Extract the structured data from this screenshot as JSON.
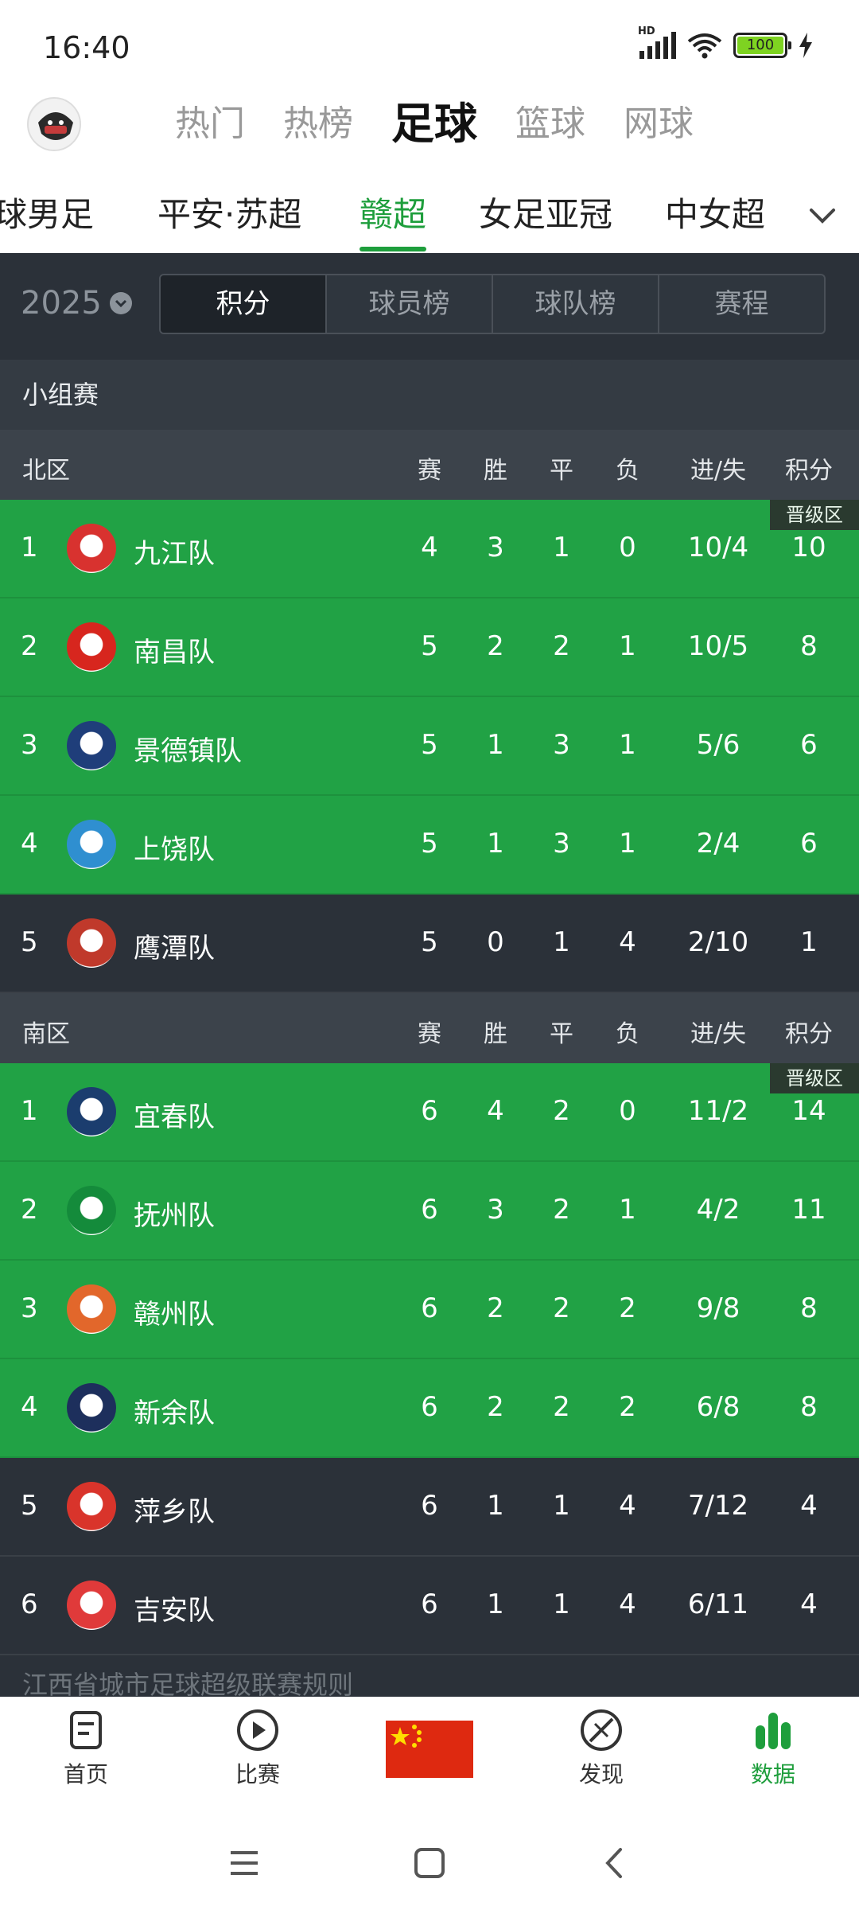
{
  "status_bar": {
    "time": "16:40",
    "network_label": "HD",
    "battery_level": "100",
    "icons": [
      "signal-icon",
      "wifi-icon",
      "battery-icon",
      "charging-icon"
    ]
  },
  "header": {
    "sport_tabs": [
      "热门",
      "热榜",
      "足球",
      "篮球",
      "网球"
    ],
    "active_sport": "足球"
  },
  "league_tabs": {
    "items": [
      "球男足",
      "平安·苏超",
      "赣超",
      "女足亚冠",
      "中女超"
    ],
    "active": "赣超"
  },
  "season": {
    "label": "2025"
  },
  "segments": {
    "items": [
      "积分",
      "球员榜",
      "球队榜",
      "赛程"
    ],
    "active": "积分"
  },
  "stage_title": "小组赛",
  "columns": {
    "gp": "赛",
    "w": "胜",
    "d": "平",
    "l": "负",
    "gd": "进/失",
    "pts": "积分"
  },
  "promotion_label": "晋级区",
  "zones": [
    {
      "name": "北区",
      "rows": [
        {
          "rank": "1",
          "team": "九江队",
          "gp": "4",
          "w": "3",
          "d": "1",
          "l": "0",
          "gd": "10/4",
          "pts": "10",
          "zone": "promotion",
          "logo_color": "#d8322f"
        },
        {
          "rank": "2",
          "team": "南昌队",
          "gp": "5",
          "w": "2",
          "d": "2",
          "l": "1",
          "gd": "10/5",
          "pts": "8",
          "zone": "promotion",
          "logo_color": "#d7261e"
        },
        {
          "rank": "3",
          "team": "景德镇队",
          "gp": "5",
          "w": "1",
          "d": "3",
          "l": "1",
          "gd": "5/6",
          "pts": "6",
          "zone": "promotion",
          "logo_color": "#1f3e7a"
        },
        {
          "rank": "4",
          "team": "上饶队",
          "gp": "5",
          "w": "1",
          "d": "3",
          "l": "1",
          "gd": "2/4",
          "pts": "6",
          "zone": "promotion",
          "logo_color": "#2f8fd0"
        },
        {
          "rank": "5",
          "team": "鹰潭队",
          "gp": "5",
          "w": "0",
          "d": "1",
          "l": "4",
          "gd": "2/10",
          "pts": "1",
          "zone": "none",
          "logo_color": "#c0392b"
        }
      ]
    },
    {
      "name": "南区",
      "rows": [
        {
          "rank": "1",
          "team": "宜春队",
          "gp": "6",
          "w": "4",
          "d": "2",
          "l": "0",
          "gd": "11/2",
          "pts": "14",
          "zone": "promotion",
          "logo_color": "#1b3d6e"
        },
        {
          "rank": "2",
          "team": "抚州队",
          "gp": "6",
          "w": "3",
          "d": "2",
          "l": "1",
          "gd": "4/2",
          "pts": "11",
          "zone": "promotion",
          "logo_color": "#148b3b"
        },
        {
          "rank": "3",
          "team": "赣州队",
          "gp": "6",
          "w": "2",
          "d": "2",
          "l": "2",
          "gd": "9/8",
          "pts": "8",
          "zone": "promotion",
          "logo_color": "#e2672b"
        },
        {
          "rank": "4",
          "team": "新余队",
          "gp": "6",
          "w": "2",
          "d": "2",
          "l": "2",
          "gd": "6/8",
          "pts": "8",
          "zone": "promotion",
          "logo_color": "#1d2f5c"
        },
        {
          "rank": "5",
          "team": "萍乡队",
          "gp": "6",
          "w": "1",
          "d": "1",
          "l": "4",
          "gd": "7/12",
          "pts": "4",
          "zone": "none",
          "logo_color": "#d9342b"
        },
        {
          "rank": "6",
          "team": "吉安队",
          "gp": "6",
          "w": "1",
          "d": "1",
          "l": "4",
          "gd": "6/11",
          "pts": "4",
          "zone": "none",
          "logo_color": "#e03a3a"
        }
      ]
    }
  ],
  "rules_link": "江西省城市足球超级联赛规则",
  "bottom_nav": {
    "items": [
      {
        "label": "首页",
        "icon": "home-doc-icon"
      },
      {
        "label": "比赛",
        "icon": "play-icon"
      },
      {
        "label": "",
        "icon": "china-flag-icon"
      },
      {
        "label": "发现",
        "icon": "discover-icon"
      },
      {
        "label": "数据",
        "icon": "data-bars-icon"
      }
    ],
    "active": "数据"
  },
  "colors": {
    "accent": "#1e9e3c",
    "promotion_bg": "#21a245",
    "dark_bg": "#2b3139"
  }
}
